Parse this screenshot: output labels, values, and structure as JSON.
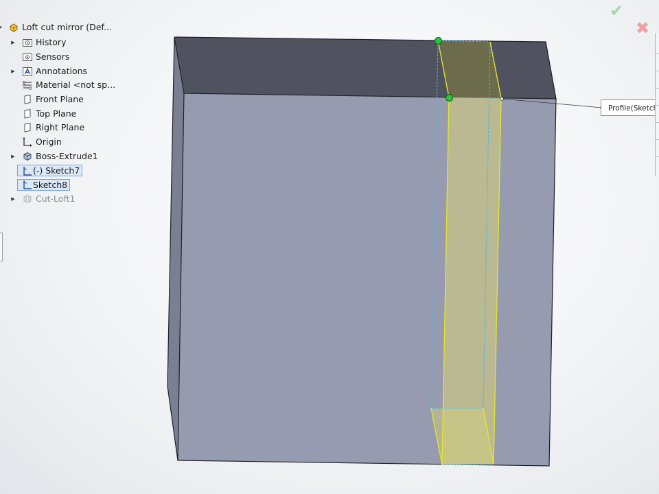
{
  "feature_tree": {
    "root": {
      "label": "Loft cut mirror  (Def..."
    },
    "items": [
      {
        "label": "History",
        "icon": "history-folder-icon",
        "expandable": true
      },
      {
        "label": "Sensors",
        "icon": "sensors-folder-icon",
        "expandable": false
      },
      {
        "label": "Annotations",
        "icon": "annotations-icon",
        "expandable": true
      },
      {
        "label": "Material <not sp...",
        "icon": "material-icon",
        "expandable": false
      },
      {
        "label": "Front Plane",
        "icon": "plane-icon",
        "expandable": false
      },
      {
        "label": "Top Plane",
        "icon": "plane-icon",
        "expandable": false
      },
      {
        "label": "Right Plane",
        "icon": "plane-icon",
        "expandable": false
      },
      {
        "label": "Origin",
        "icon": "origin-icon",
        "expandable": false
      },
      {
        "label": "Boss-Extrude1",
        "icon": "extrude-feature-icon",
        "expandable": true
      },
      {
        "label": "(-) Sketch7",
        "icon": "sketch-icon",
        "expandable": false,
        "selected": true
      },
      {
        "label": "Sketch8",
        "icon": "sketch-icon",
        "expandable": false,
        "selected": true
      },
      {
        "label": "Cut-Loft1",
        "icon": "loft-cut-feature-icon",
        "expandable": true,
        "suppressed": true
      }
    ]
  },
  "callout": {
    "label": "Profile(Sketch"
  },
  "confirm": {
    "ok_icon": "checkmark-icon",
    "cancel_icon": "close-icon",
    "ok_color": "#a8d8a8",
    "cancel_color": "#f0a0a0"
  },
  "colors": {
    "model_front": "#969bb0",
    "model_top": "#50525f",
    "model_side": "#7b7f92",
    "edge": "#1e1f26",
    "preview_fill": "#d8d27a",
    "preview_edge": "#e3e52a",
    "preview_dash": "#49b6e6",
    "handle": "#2fbf3a"
  }
}
